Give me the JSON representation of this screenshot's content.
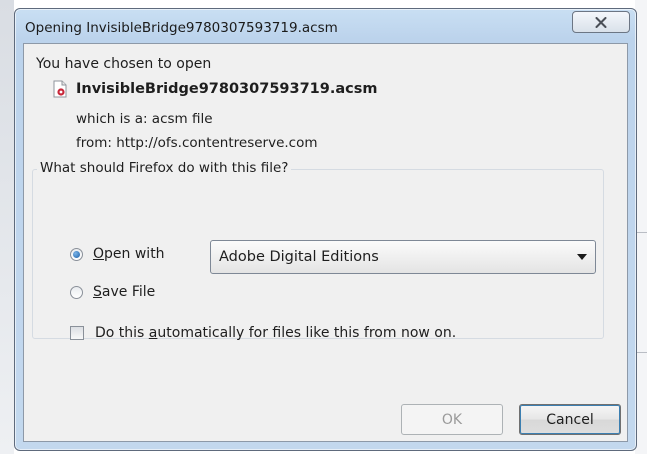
{
  "window": {
    "title": "Opening InvisibleBridge9780307593719.acsm",
    "close_glyph": "X"
  },
  "content": {
    "intro": "You have chosen to open",
    "file_name": "InvisibleBridge9780307593719.acsm",
    "which_is": "which is a:  acsm file",
    "from": "from:  http://ofs.contentreserve.com"
  },
  "action_group": {
    "legend": "What should Firefox do with this file?",
    "open_with": {
      "label_mnemonic": "O",
      "label_rest": "pen with",
      "selected": true
    },
    "application": "Adobe Digital Editions",
    "save_file": {
      "label_mnemonic": "S",
      "label_rest": "ave File",
      "selected": false
    },
    "auto": {
      "label_before": "Do this ",
      "label_mnemonic": "a",
      "label_after": "utomatically for files like this from now on.",
      "checked": false
    }
  },
  "buttons": {
    "ok": "OK",
    "cancel": "Cancel"
  },
  "icons": {
    "file": "acsm-file-icon",
    "close": "close-icon",
    "dropdown": "chevron-down-icon"
  },
  "colors": {
    "title_gradient_top": "#c9dff3",
    "client_bg": "#f0f0f0",
    "radio_selected": "#1c5fa8"
  }
}
